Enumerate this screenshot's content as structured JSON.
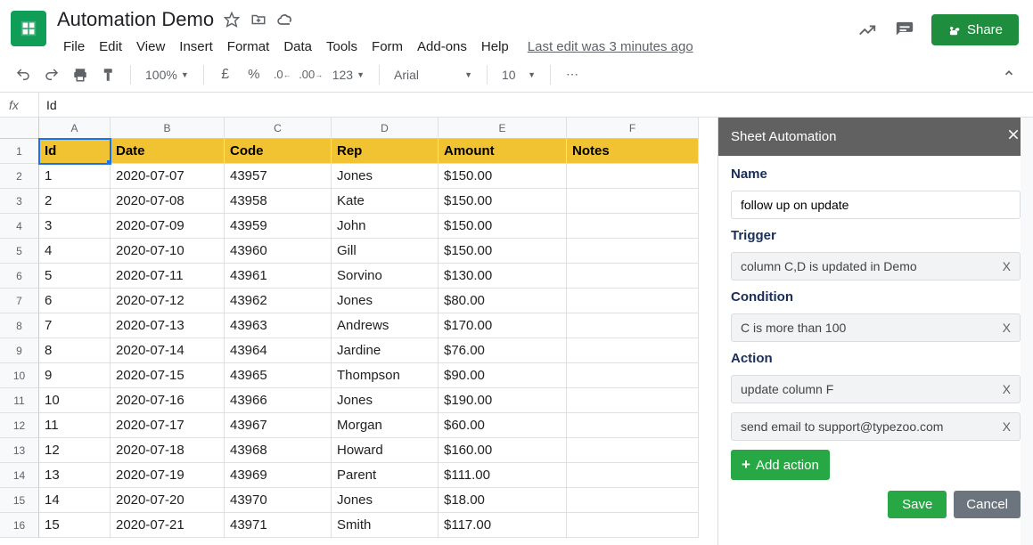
{
  "doc_title": "Automation Demo",
  "menu": [
    "File",
    "Edit",
    "View",
    "Insert",
    "Format",
    "Data",
    "Tools",
    "Form",
    "Add-ons",
    "Help"
  ],
  "last_edit": "Last edit was 3 minutes ago",
  "share_label": "Share",
  "toolbar": {
    "zoom": "100%",
    "font": "Arial",
    "font_size": "10",
    "num_format": "123"
  },
  "formula": {
    "fx": "fx",
    "value": "Id"
  },
  "columns": [
    "A",
    "B",
    "C",
    "D",
    "E",
    "F"
  ],
  "header_row": [
    "Id",
    "Date",
    "Code",
    "Rep",
    "Amount",
    "Notes"
  ],
  "rows": [
    {
      "n": 1,
      "id": "1",
      "date": "2020-07-07",
      "code": "43957",
      "rep": "Jones",
      "amount": "$150.00",
      "notes": ""
    },
    {
      "n": 2,
      "id": "2",
      "date": "2020-07-08",
      "code": "43958",
      "rep": "Kate",
      "amount": "$150.00",
      "notes": ""
    },
    {
      "n": 3,
      "id": "3",
      "date": "2020-07-09",
      "code": "43959",
      "rep": "John",
      "amount": "$150.00",
      "notes": ""
    },
    {
      "n": 4,
      "id": "4",
      "date": "2020-07-10",
      "code": "43960",
      "rep": "Gill",
      "amount": "$150.00",
      "notes": ""
    },
    {
      "n": 5,
      "id": "5",
      "date": "2020-07-11",
      "code": "43961",
      "rep": "Sorvino",
      "amount": "$130.00",
      "notes": ""
    },
    {
      "n": 6,
      "id": "6",
      "date": "2020-07-12",
      "code": "43962",
      "rep": "Jones",
      "amount": "$80.00",
      "notes": ""
    },
    {
      "n": 7,
      "id": "7",
      "date": "2020-07-13",
      "code": "43963",
      "rep": "Andrews",
      "amount": "$170.00",
      "notes": ""
    },
    {
      "n": 8,
      "id": "8",
      "date": "2020-07-14",
      "code": "43964",
      "rep": "Jardine",
      "amount": "$76.00",
      "notes": ""
    },
    {
      "n": 9,
      "id": "9",
      "date": "2020-07-15",
      "code": "43965",
      "rep": "Thompson",
      "amount": "$90.00",
      "notes": ""
    },
    {
      "n": 10,
      "id": "10",
      "date": "2020-07-16",
      "code": "43966",
      "rep": "Jones",
      "amount": "$190.00",
      "notes": ""
    },
    {
      "n": 11,
      "id": "11",
      "date": "2020-07-17",
      "code": "43967",
      "rep": "Morgan",
      "amount": "$60.00",
      "notes": ""
    },
    {
      "n": 12,
      "id": "12",
      "date": "2020-07-18",
      "code": "43968",
      "rep": "Howard",
      "amount": "$160.00",
      "notes": ""
    },
    {
      "n": 13,
      "id": "13",
      "date": "2020-07-19",
      "code": "43969",
      "rep": "Parent",
      "amount": "$111.00",
      "notes": ""
    },
    {
      "n": 14,
      "id": "14",
      "date": "2020-07-20",
      "code": "43970",
      "rep": "Jones",
      "amount": "$18.00",
      "notes": ""
    },
    {
      "n": 15,
      "id": "15",
      "date": "2020-07-21",
      "code": "43971",
      "rep": "Smith",
      "amount": "$117.00",
      "notes": ""
    }
  ],
  "panel": {
    "title": "Sheet Automation",
    "name_label": "Name",
    "name_value": "follow up on update",
    "trigger_label": "Trigger",
    "trigger_value": "column C,D is updated in Demo",
    "condition_label": "Condition",
    "condition_value": "C is more than 100",
    "action_label": "Action",
    "action1": "update column F",
    "action2": "send email to support@typezoo.com",
    "add_action": "Add action",
    "save": "Save",
    "cancel": "Cancel",
    "x": "X"
  }
}
